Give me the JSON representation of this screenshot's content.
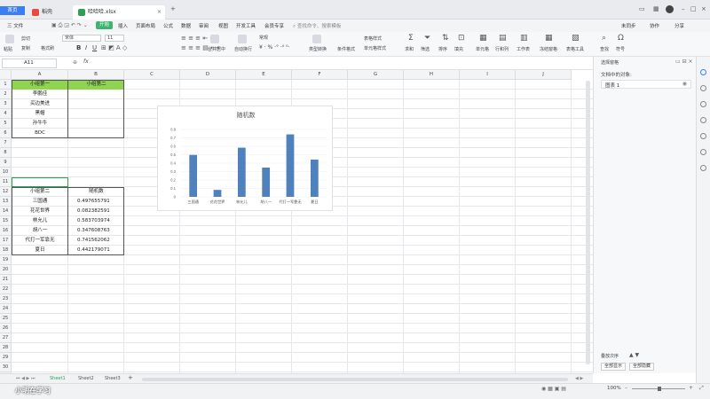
{
  "titlebar": {
    "home_tab": "首页",
    "tab1": "稻壳",
    "tab2": "哈哈哈.xlsx",
    "brand_color": "#3a7ef5"
  },
  "menubar": {
    "file": "三 文件",
    "items": [
      "开始",
      "插入",
      "页面布局",
      "公式",
      "数据",
      "审阅",
      "视图",
      "开发工具",
      "会员专享"
    ],
    "active_index": 0,
    "search": "查找命令、搜索模板",
    "right": [
      "未同步",
      "协作",
      "分享"
    ]
  },
  "ribbon": {
    "paste": "粘贴",
    "cut": "剪切",
    "copy": "复制",
    "format_painter": "格式刷",
    "font": "宋体",
    "size": "11",
    "merge": "合并居中",
    "wrap": "自动换行",
    "numfmt": "常规",
    "condfmt": "条件格式",
    "tablestyle": "表格样式",
    "cellstyle": "单元格样式",
    "sum": "求和",
    "filter": "筛选",
    "sort": "排序",
    "fill": "填充",
    "cell": "单元格",
    "rowcol": "行和列",
    "sheet": "工作表",
    "freeze": "冻结窗格",
    "tabletools": "表格工具",
    "find": "查找",
    "symbol": "符号"
  },
  "formula": {
    "namebox": "A11",
    "fx": "fx"
  },
  "columns": [
    "A",
    "B",
    "C",
    "D",
    "E",
    "F",
    "G",
    "H",
    "I",
    "J"
  ],
  "rows": [
    "1",
    "2",
    "3",
    "4",
    "5",
    "6",
    "7",
    "8",
    "9",
    "10",
    "11",
    "12",
    "13",
    "14",
    "15",
    "16",
    "17",
    "18",
    "19",
    "20",
    "21",
    "22",
    "23",
    "24",
    "25",
    "26",
    "27",
    "28",
    "29",
    "30",
    "31"
  ],
  "table1": {
    "header": [
      "小组第一",
      "小组第二"
    ],
    "names": [
      "李鹏佳",
      "买边美进",
      "黑帽",
      "孙牛牛",
      "BDC"
    ]
  },
  "table2": {
    "header": [
      "小组第二",
      "随机数"
    ],
    "rows": [
      [
        "三国通",
        "0.497655791"
      ],
      [
        "花花世界",
        "0.082382591"
      ],
      [
        "林允儿",
        "0.583703974"
      ],
      [
        "胡八一",
        "0.347608763"
      ],
      [
        "代打一军靠无",
        "0.741562062"
      ],
      [
        "夏日",
        "0.442179071"
      ]
    ]
  },
  "chart_data": {
    "type": "bar",
    "title": "随机数",
    "categories": [
      "三国通",
      "花花世界",
      "林允儿",
      "胡八一",
      "代打一军靠无",
      "夏日"
    ],
    "values": [
      0.497655791,
      0.082382591,
      0.583703974,
      0.347608763,
      0.741562062,
      0.442179071
    ],
    "ylim": [
      0,
      0.8
    ],
    "yticks": [
      "0",
      "0.1",
      "0.2",
      "0.3",
      "0.4",
      "0.5",
      "0.6",
      "0.7",
      "0.8"
    ],
    "bar_color": "#4f81bd",
    "grid": true
  },
  "sheets": [
    "Sheet1",
    "Sheet2",
    "Sheet3"
  ],
  "active_sheet": 0,
  "rightpane": {
    "title": "选择窗格",
    "subtitle": "文档中的对象:",
    "object": "图表 1",
    "btn_show_all": "全部显示",
    "btn_hide_all": "全部隐藏",
    "order": "叠放次序"
  },
  "status": {
    "zoom": "100%"
  },
  "overlay": "小明在学习"
}
